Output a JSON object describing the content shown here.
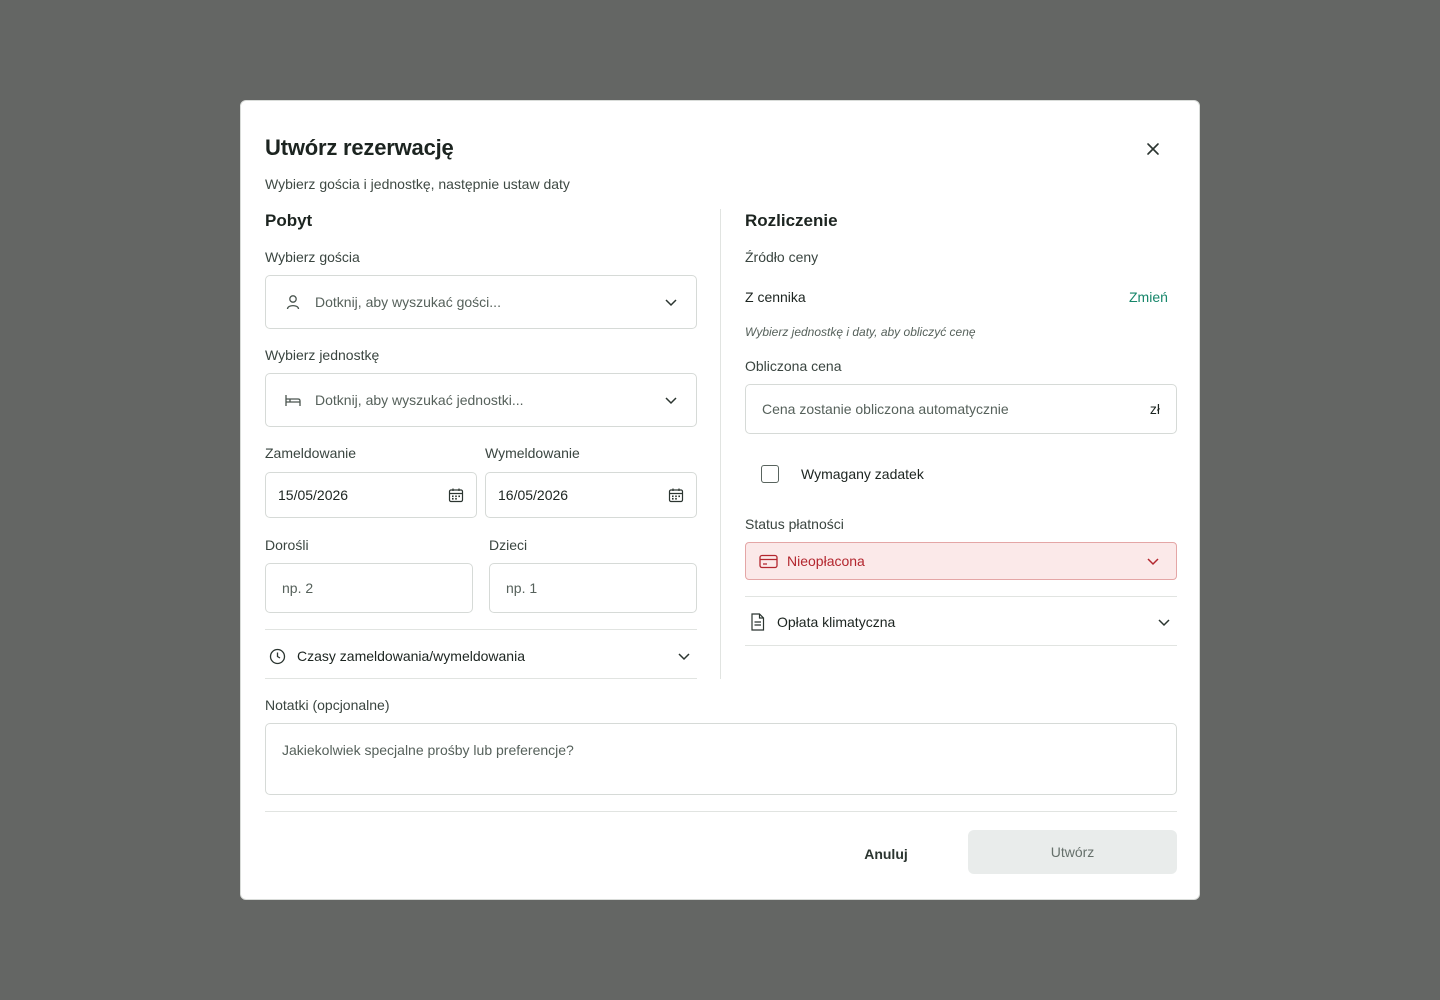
{
  "dialog": {
    "title": "Utwórz rezerwację",
    "subtitle": "Wybierz gościa i jednostkę, następnie ustaw daty"
  },
  "stay": {
    "section_title": "Pobyt",
    "guest_label": "Wybierz gościa",
    "guest_placeholder": "Dotknij, aby wyszukać gości...",
    "unit_label": "Wybierz jednostkę",
    "unit_placeholder": "Dotknij, aby wyszukać jednostki...",
    "checkin_label": "Zameldowanie",
    "checkin_value": "15/05/2026",
    "checkout_label": "Wymeldowanie",
    "checkout_value": "16/05/2026",
    "adults_label": "Dorośli",
    "adults_placeholder": "np. 2",
    "children_label": "Dzieci",
    "children_placeholder": "np. 1",
    "times_label": "Czasy zameldowania/wymeldowania"
  },
  "billing": {
    "section_title": "Rozliczenie",
    "price_source_label": "Źródło ceny",
    "price_source_value": "Z cennika",
    "change_link": "Zmień",
    "price_hint": "Wybierz jednostkę i daty, aby obliczyć cenę",
    "calculated_label": "Obliczona cena",
    "calculated_placeholder": "Cena zostanie obliczona automatycznie",
    "currency": "zł",
    "deposit_label": "Wymagany zadatek",
    "deposit_checked": false,
    "payment_status_label": "Status płatności",
    "payment_status_value": "Nieopłacona",
    "climate_fee_label": "Opłata klimatyczna"
  },
  "notes": {
    "label": "Notatki (opcjonalne)",
    "placeholder": "Jakiekolwiek specjalne prośby lub preferencje?"
  },
  "footer": {
    "cancel_label": "Anuluj",
    "create_label": "Utwórz"
  },
  "colors": {
    "overlay": "#646664",
    "accent_link": "#16866a",
    "unpaid_bg": "#fbe9e9",
    "unpaid_text": "#b3262e"
  }
}
